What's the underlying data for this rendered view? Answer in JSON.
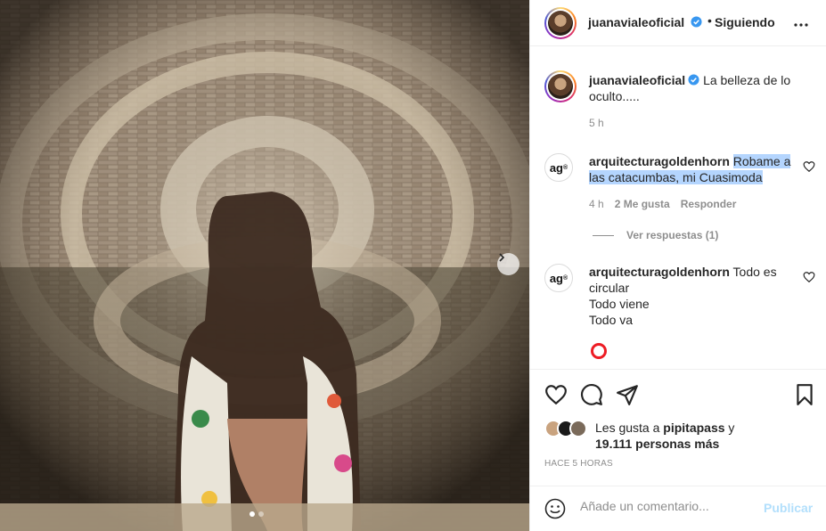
{
  "post": {
    "photo_alt": "",
    "carousel": {
      "count": 2,
      "active": 1
    }
  },
  "header": {
    "username": "juanavialeoficial",
    "separator": "•",
    "follow_label": "Siguiendo",
    "more_label": "•••"
  },
  "caption": {
    "username": "juanavialeoficial",
    "text": "La belleza de lo oculto.....",
    "time": "5 h"
  },
  "comments": [
    {
      "username": "arquitecturagoldenhorn",
      "avatar_text": "ag",
      "text_highlighted": "Robame a las catacumbas, mi Cuasimoda",
      "time": "4 h",
      "likes": "2 Me gusta",
      "reply_label": "Responder",
      "view_replies": "Ver respuestas (1)"
    },
    {
      "username": "arquitecturagoldenhorn",
      "avatar_text": "ag",
      "lines": [
        "Todo es circular",
        "Todo viene",
        "Todo va"
      ]
    }
  ],
  "likes": {
    "prefix": "Les gusta a",
    "user": "pipitapass",
    "connector": "y",
    "others": "19.111 personas más"
  },
  "timestamp": "HACE 5 HORAS",
  "comment_box": {
    "placeholder": "Añade un comentario...",
    "publish_label": "Publicar"
  },
  "colors": {
    "verified": "#3897f0",
    "publish_disabled": "#b2dffc",
    "highlight": "#b4d5fe",
    "loader": "#ed1c24"
  }
}
